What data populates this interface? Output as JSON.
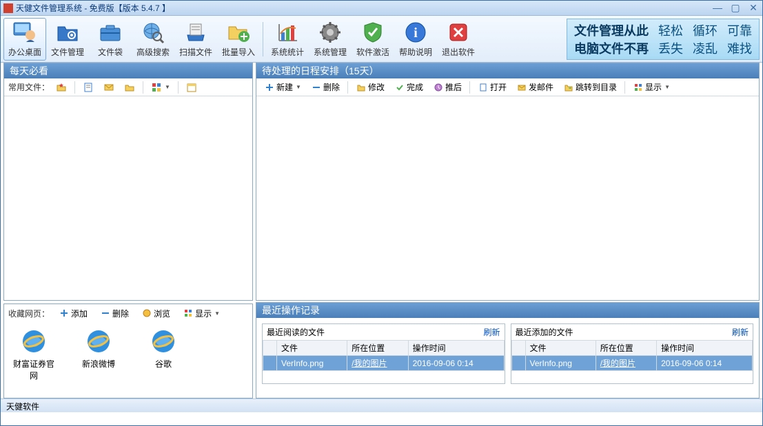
{
  "title": "天健文件管理系统  -  免费版【版本  5.4.7 】",
  "toolbar": [
    {
      "label": "办公桌面",
      "active": true
    },
    {
      "label": "文件管理"
    },
    {
      "label": "文件袋"
    },
    {
      "label": "高级搜索"
    },
    {
      "label": "扫描文件"
    },
    {
      "label": "批量导入"
    },
    {
      "label": "系统统计"
    },
    {
      "label": "系统管理"
    },
    {
      "label": "软件激活"
    },
    {
      "label": "帮助说明"
    },
    {
      "label": "退出软件"
    }
  ],
  "banner": {
    "line1_main": "文件管理从此",
    "line1_words": [
      "轻松",
      "循环",
      "可靠"
    ],
    "line2_main": "电脑文件不再",
    "line2_words": [
      "丢失",
      "凌乱",
      "难找"
    ]
  },
  "daily": {
    "title": "每天必看",
    "common_label": "常用文件："
  },
  "bookmarks": {
    "label": "收藏网页：",
    "add": "添加",
    "delete": "删除",
    "browse": "浏览",
    "display": "显示",
    "items": [
      {
        "label": "财富证券官网"
      },
      {
        "label": "新浪微博"
      },
      {
        "label": "谷歌"
      }
    ]
  },
  "schedule": {
    "title": "待处理的日程安排（15天）",
    "new": "新建",
    "delete": "删除",
    "modify": "修改",
    "complete": "完成",
    "postpone": "推后",
    "open": "打开",
    "sendmail": "发邮件",
    "jumpdir": "跳转到目录",
    "display": "显示"
  },
  "recent": {
    "title": "最近操作记录",
    "read_title": "最近阅读的文件",
    "add_title": "最近添加的文件",
    "refresh": "刷新",
    "cols": {
      "file": "文件",
      "location": "所在位置",
      "time": "操作时间"
    },
    "read_rows": [
      {
        "file": "VerInfo.png",
        "location": "/我的图片",
        "time": "2016-09-06 0:14"
      }
    ],
    "add_rows": [
      {
        "file": "VerInfo.png",
        "location": "/我的图片",
        "time": "2016-09-06 0:14"
      }
    ]
  },
  "status": "天健软件"
}
